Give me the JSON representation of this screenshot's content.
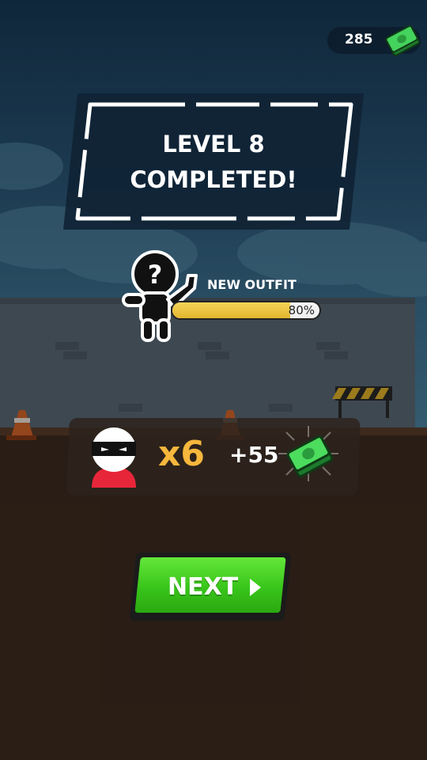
{
  "hud": {
    "currency_amount": "285",
    "currency_icon": "cash-stack-icon"
  },
  "banner": {
    "line1": "LEVEL 8",
    "line2": "COMPLETED!"
  },
  "outfit": {
    "label": "NEW OUTFIT",
    "progress_percent": 80,
    "progress_text": "80%",
    "mystery_icon": "question-mark-silhouette-icon"
  },
  "reward": {
    "enemy_icon": "masked-enemy-icon",
    "multiplier": "x6",
    "amount": "+55",
    "cash_icon": "cash-stack-icon"
  },
  "next_button": {
    "label": "NEXT",
    "icon": "play-arrow-icon"
  },
  "colors": {
    "accent_yellow": "#f6b73c",
    "progress_fill": "#e8c23a",
    "button_green": "#3ccb1d",
    "cash_green": "#2fb84a"
  }
}
